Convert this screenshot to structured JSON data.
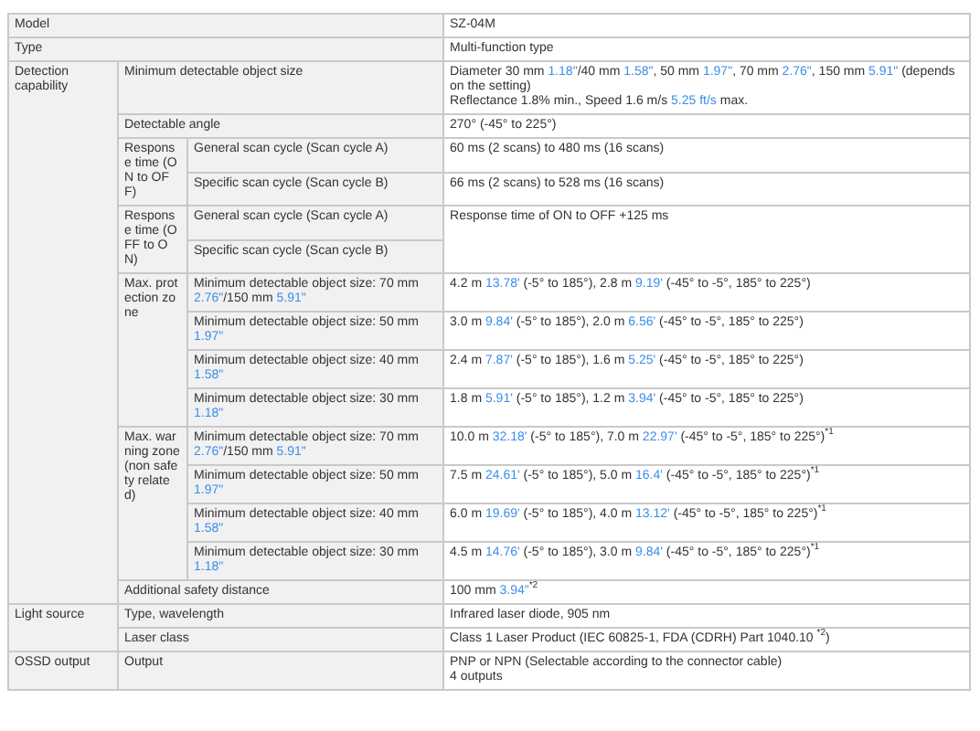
{
  "sections": [
    {
      "label": [
        [
          "Model"
        ]
      ],
      "value": [
        [
          "SZ-04M"
        ]
      ]
    },
    {
      "label": [
        [
          "Type"
        ]
      ],
      "value": [
        [
          "Multi-function type"
        ]
      ]
    },
    {
      "label": [
        [
          "Detection capability"
        ]
      ],
      "items": [
        {
          "label": [
            [
              "Minimum detectable object size"
            ]
          ],
          "value": [
            [
              "Diameter 30 mm ",
              {
                "unit": "1.18\""
              },
              "/40 mm ",
              {
                "unit": "1.58\""
              },
              ", 50 mm ",
              {
                "unit": "1.97\""
              },
              ", 70 mm ",
              {
                "unit": "2.76\""
              },
              ", 150 mm ",
              {
                "unit": "5.91\""
              },
              " (depends on the setting)"
            ],
            [
              "Reflectance 1.8% min., Speed 1.6 m/s ",
              {
                "unit": "5.25 ft/s"
              },
              " max."
            ]
          ]
        },
        {
          "label": [
            [
              "Detectable angle"
            ]
          ],
          "value": [
            [
              "270° (-45° to 225°)"
            ]
          ]
        },
        {
          "label": [
            [
              "Response time (ON to OFF)"
            ]
          ],
          "items": [
            {
              "label": [
                [
                  "General scan cycle (Scan cycle A)"
                ]
              ],
              "value": [
                [
                  "60 ms (2 scans) to 480 ms (16 scans)"
                ]
              ]
            },
            {
              "label": [
                [
                  "Specific scan cycle (Scan cycle B)"
                ]
              ],
              "value": [
                [
                  "66 ms (2 scans) to 528 ms (16 scans)"
                ]
              ]
            }
          ]
        },
        {
          "label": [
            [
              "Response time (OFF to ON)"
            ]
          ],
          "items": [
            {
              "label": [
                [
                  "General scan cycle (Scan cycle A)"
                ]
              ],
              "value": [
                [
                  "Response time of ON to OFF +125 ms"
                ]
              ]
            },
            {
              "label": [
                [
                  "Specific scan cycle (Scan cycle B)"
                ]
              ]
            }
          ]
        },
        {
          "label": [
            [
              "Max. protection zone"
            ]
          ],
          "items": [
            {
              "label": [
                [
                  "Minimum detectable object size: 70 mm ",
                  {
                    "unit": "2.76\""
                  },
                  "/150 mm ",
                  {
                    "unit": "5.91\""
                  }
                ]
              ],
              "value": [
                [
                  "4.2 m ",
                  {
                    "unit": "13.78'"
                  },
                  " (-5° to 185°), 2.8 m ",
                  {
                    "unit": "9.19'"
                  },
                  " (-45° to -5°, 185° to 225°)"
                ]
              ]
            },
            {
              "label": [
                [
                  "Minimum detectable object size: 50 mm ",
                  {
                    "unit": "1.97\""
                  }
                ]
              ],
              "value": [
                [
                  "3.0 m ",
                  {
                    "unit": "9.84'"
                  },
                  " (-5° to 185°), 2.0 m ",
                  {
                    "unit": "6.56'"
                  },
                  " (-45° to -5°, 185° to 225°)"
                ]
              ]
            },
            {
              "label": [
                [
                  "Minimum detectable object size: 40 mm ",
                  {
                    "unit": "1.58\""
                  }
                ]
              ],
              "value": [
                [
                  "2.4 m ",
                  {
                    "unit": "7.87'"
                  },
                  " (-5° to 185°), 1.6 m ",
                  {
                    "unit": "5.25'"
                  },
                  " (-45° to -5°, 185° to 225°)"
                ]
              ]
            },
            {
              "label": [
                [
                  "Minimum detectable object size: 30 mm ",
                  {
                    "unit": "1.18\""
                  }
                ]
              ],
              "value": [
                [
                  "1.8 m ",
                  {
                    "unit": "5.91'"
                  },
                  " (-5° to 185°), 1.2 m ",
                  {
                    "unit": "3.94'"
                  },
                  " (-45° to -5°, 185° to 225°)"
                ]
              ]
            }
          ]
        },
        {
          "label": [
            [
              "Max. warning zone (non safety related)"
            ]
          ],
          "items": [
            {
              "label": [
                [
                  "Minimum detectable object size: 70 mm ",
                  {
                    "unit": "2.76\""
                  },
                  "/150 mm ",
                  {
                    "unit": "5.91\""
                  }
                ]
              ],
              "value": [
                [
                  "10.0 m ",
                  {
                    "unit": "32.18'"
                  },
                  " (-5° to 185°), 7.0 m ",
                  {
                    "unit": "22.97'"
                  },
                  " (-45° to -5°, 185° to 225°)$^{*1}$"
                ]
              ]
            },
            {
              "label": [
                [
                  "Minimum detectable object size: 50 mm ",
                  {
                    "unit": "1.97\""
                  }
                ]
              ],
              "value": [
                [
                  "7.5 m ",
                  {
                    "unit": "24.61'"
                  },
                  " (-5° to 185°), 5.0 m ",
                  {
                    "unit": "16.4'"
                  },
                  " (-45° to -5°, 185° to 225°)$^{*1}$"
                ]
              ]
            },
            {
              "label": [
                [
                  "Minimum detectable object size: 40 mm ",
                  {
                    "unit": "1.58\""
                  }
                ]
              ],
              "value": [
                [
                  "6.0 m ",
                  {
                    "unit": "19.69'"
                  },
                  " (-5° to 185°), 4.0 m ",
                  {
                    "unit": "13.12'"
                  },
                  " (-45° to -5°, 185° to 225°)$^{*1}$"
                ]
              ]
            },
            {
              "label": [
                [
                  "Minimum detectable object size: 30 mm ",
                  {
                    "unit": "1.18\""
                  }
                ]
              ],
              "value": [
                [
                  "4.5 m ",
                  {
                    "unit": "14.76'"
                  },
                  " (-5° to 185°), 3.0 m ",
                  {
                    "unit": "9.84'"
                  },
                  " (-45° to -5°, 185° to 225°)$^{*1}$"
                ]
              ]
            }
          ]
        },
        {
          "label": [
            [
              "Additional safety distance"
            ]
          ],
          "value": [
            [
              "100 mm ",
              {
                "unit": "3.94\""
              },
              "$^{*2}$"
            ]
          ]
        }
      ]
    },
    {
      "label": [
        [
          "Light source"
        ]
      ],
      "items": [
        {
          "label": [
            [
              "Type, wavelength"
            ]
          ],
          "value": [
            [
              "Infrared laser diode, 905 nm"
            ]
          ]
        },
        {
          "label": [
            [
              "Laser class"
            ]
          ],
          "value": [
            [
              "Class 1 Laser Product (IEC 60825-1, FDA (CDRH) Part 1040.10 $^{*2}$)"
            ]
          ]
        }
      ]
    },
    {
      "label": [
        [
          "OSSD output"
        ]
      ],
      "items": [
        {
          "label": [
            [
              "Output"
            ]
          ],
          "value": [
            [
              "PNP or NPN (Selectable according to the connector cable)"
            ],
            [
              "4 outputs"
            ]
          ]
        }
      ]
    }
  ]
}
